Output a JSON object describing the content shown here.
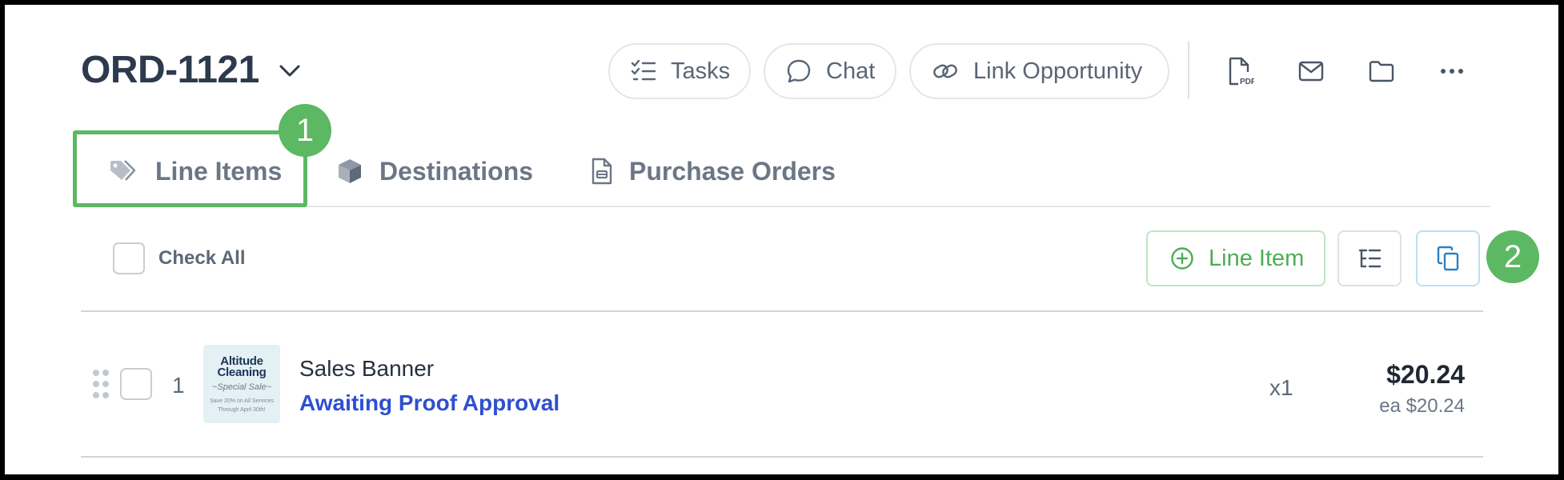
{
  "header": {
    "order_number": "ORD-1121",
    "buttons": {
      "tasks": "Tasks",
      "chat": "Chat",
      "link_opportunity": "Link Opportunity"
    },
    "icon_actions": [
      "pdf-icon",
      "mail-icon",
      "folder-icon",
      "more-icon"
    ]
  },
  "tabs": [
    {
      "label": "Line Items",
      "icon": "tag-icon",
      "active": true
    },
    {
      "label": "Destinations",
      "icon": "box-icon"
    },
    {
      "label": "Purchase Orders",
      "icon": "document-icon"
    }
  ],
  "callouts": {
    "first": "1",
    "second": "2"
  },
  "toolbar": {
    "check_all_label": "Check All",
    "add_line_item_label": "Line Item"
  },
  "line_items": [
    {
      "index": "1",
      "name": "Sales Banner",
      "status": "Awaiting Proof Approval",
      "quantity": "x1",
      "total": "$20.24",
      "each": "ea $20.24",
      "thumbnail": {
        "title_line1": "Altitude",
        "title_line2": "Cleaning",
        "subtitle": "~Special Sale~",
        "fine_line1": "Save 20% on All Services",
        "fine_line2": "Through April 30th!"
      }
    }
  ],
  "colors": {
    "callout_green": "#5cb862",
    "status_link": "#2e4fd0",
    "line_item_green": "#4cae55"
  }
}
